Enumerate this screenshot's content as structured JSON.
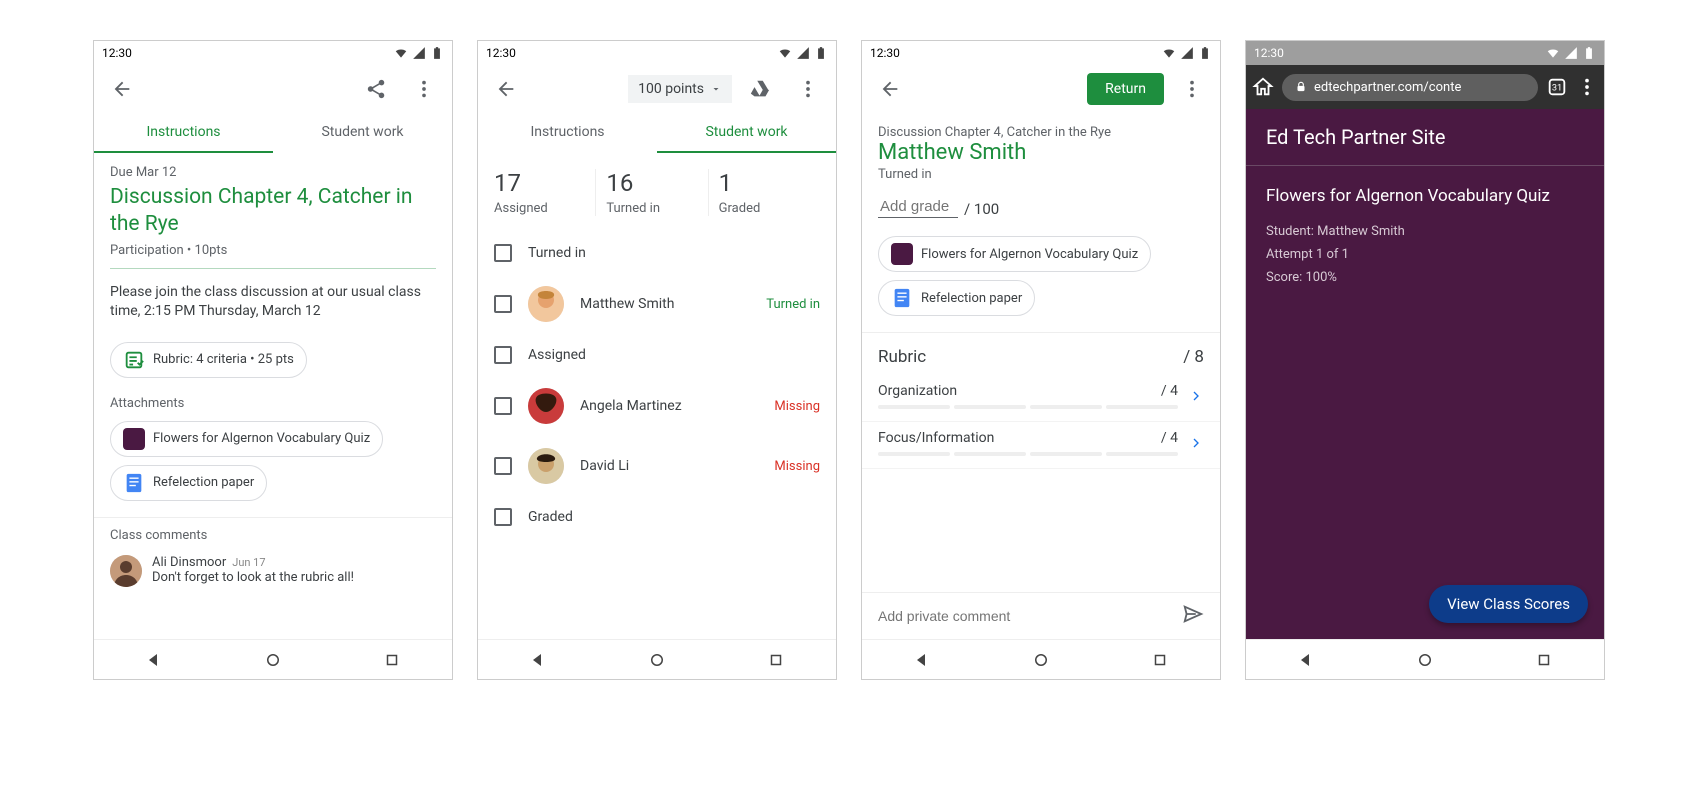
{
  "status_time": "12:30",
  "screen1": {
    "tabs": {
      "instructions": "Instructions",
      "student_work": "Student work"
    },
    "due": "Due Mar 12",
    "title": "Discussion Chapter 4, Catcher in the Rye",
    "meta": "Participation • 10pts",
    "description": "Please join the class discussion at our usual class time, 2:15 PM Thursday, March 12",
    "rubric_chip": "Rubric: 4 criteria • 25 pts",
    "attachments_label": "Attachments",
    "attachments": [
      {
        "label": "Flowers for Algernon Vocabulary Quiz",
        "icon": "purple"
      },
      {
        "label": "Refelection paper",
        "icon": "docs"
      }
    ],
    "comments_label": "Class comments",
    "comment": {
      "author": "Ali Dinsmoor",
      "date": "Jun 17",
      "text": "Don't forget to look at the rubric all!"
    }
  },
  "screen2": {
    "points": "100 points",
    "tabs": {
      "instructions": "Instructions",
      "student_work": "Student work"
    },
    "stats": [
      {
        "num": "17",
        "label": "Assigned"
      },
      {
        "num": "16",
        "label": "Turned in"
      },
      {
        "num": "1",
        "label": "Graded"
      }
    ],
    "sections": {
      "turned_in": "Turned in",
      "assigned": "Assigned",
      "graded": "Graded"
    },
    "students": {
      "matthew": {
        "name": "Matthew Smith",
        "status": "Turned in"
      },
      "angela": {
        "name": "Angela Martinez",
        "status": "Missing"
      },
      "david": {
        "name": "David Li",
        "status": "Missing"
      }
    }
  },
  "screen3": {
    "return_btn": "Return",
    "assignment": "Discussion Chapter 4, Catcher in the Rye",
    "student": "Matthew Smith",
    "status": "Turned in",
    "grade_placeholder": "Add grade",
    "grade_denom": "/ 100",
    "attachments": [
      {
        "label": "Flowers for Algernon Vocabulary Quiz",
        "icon": "purple"
      },
      {
        "label": "Refelection paper",
        "icon": "docs"
      }
    ],
    "rubric_label": "Rubric",
    "rubric_total": "/ 8",
    "rubric_items": [
      {
        "name": "Organization",
        "max": "/ 4"
      },
      {
        "name": "Focus/Information",
        "max": "/ 4"
      }
    ],
    "private_comment_placeholder": "Add private comment"
  },
  "screen4": {
    "url": "edtechpartner.com/conte",
    "site_title": "Ed Tech Partner Site",
    "quiz_title": "Flowers for Algernon Vocabulary Quiz",
    "student_line": "Student: Matthew Smith",
    "attempt_line": "Attempt 1 of 1",
    "score_line": "Score: 100%",
    "cta": "View Class Scores"
  }
}
